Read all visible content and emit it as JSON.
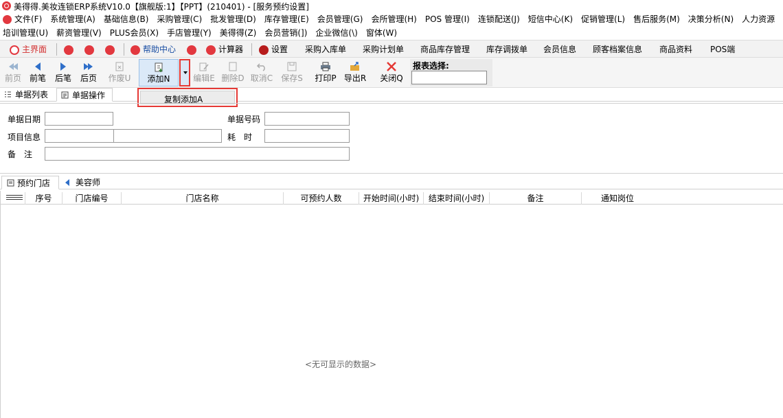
{
  "window": {
    "title": "美得得.美妆连锁ERP系统V10.0【旗舰版:1】【PPT】(210401) - [服务预约设置]"
  },
  "menu": {
    "row1": [
      "文件(F)",
      "系统管理(A)",
      "基础信息(B)",
      "采购管理(C)",
      "批发管理(D)",
      "库存管理(E)",
      "会员管理(G)",
      "会所管理(H)",
      "POS 管理(I)",
      "连锁配送(J)",
      "短信中心(K)",
      "促销管理(L)",
      "售后服务(M)",
      "决策分析(N)",
      "人力资源"
    ],
    "row2": [
      "培训管理(U)",
      "薪资管理(V)",
      "PLUS会员(X)",
      "手店管理(Y)",
      "美得得(Z)",
      "会员营销(])",
      "企业微信(\\)",
      "窗体(W)"
    ]
  },
  "quickbar": {
    "main": "主界面",
    "help": "帮助中心",
    "calculator": "计算器",
    "settings": "设置",
    "purchase_in": "采购入库单",
    "purchase_plan": "采购计划单",
    "stock_mgmt": "商品库存管理",
    "transfer": "库存调拨单",
    "member_info": "会员信息",
    "customer_profile": "顾客档案信息",
    "product_info": "商品资料",
    "pos": "POS端"
  },
  "toolbar": {
    "first": "前页",
    "prev": "前笔",
    "next": "后笔",
    "last": "后页",
    "void": "作废U",
    "add": "添加N",
    "edit": "编辑E",
    "delete": "删除D",
    "cancel": "取消C",
    "save": "保存S",
    "print": "打印P",
    "export": "导出R",
    "close": "关闭Q",
    "report_label": "报表选择:"
  },
  "tabs": {
    "list": "单据列表",
    "operation": "单据操作"
  },
  "dropdown_menu": {
    "copy_add": "复制添加A"
  },
  "form": {
    "date_label": "单据日期",
    "number_label": "单据号码",
    "project_label": "项目信息",
    "time_label": "耗　时",
    "remark_label": "备　注"
  },
  "subtabs": {
    "store": "预约门店",
    "beautician": "美容师"
  },
  "grid": {
    "columns": [
      "序号",
      "门店编号",
      "门店名称",
      "可预约人数",
      "开始时间(小时)",
      "结束时间(小时)",
      "备注",
      "通知岗位"
    ],
    "empty_text": "<无可显示的数据>"
  },
  "colors": {
    "accent_red": "#e53935",
    "active_blue": "#dbe9f8",
    "icon_red": "#e2383f",
    "icon_blue": "#2f6fc9"
  }
}
